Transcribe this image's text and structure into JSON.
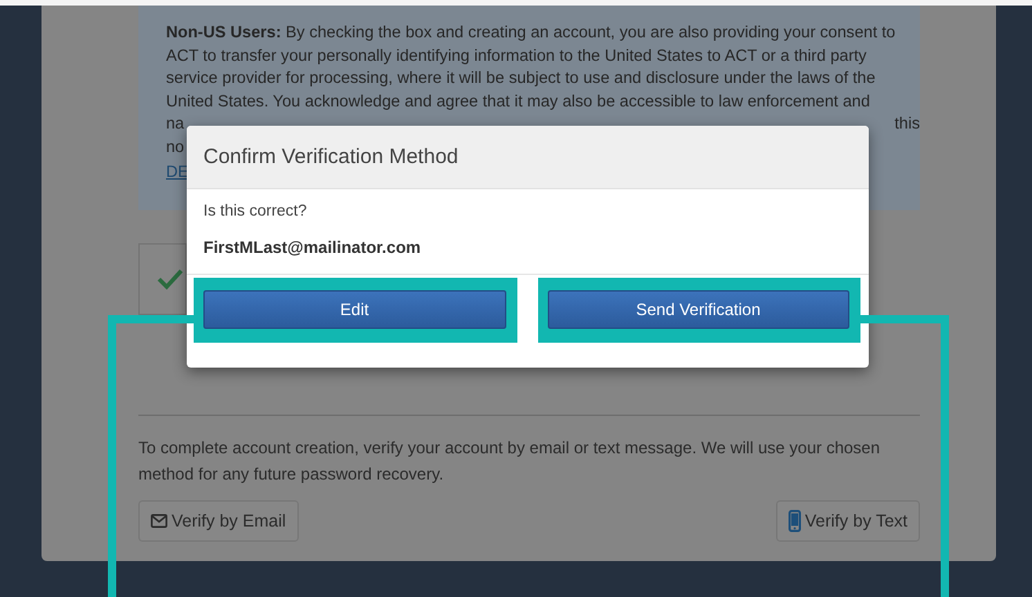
{
  "notice": {
    "text": "**Non-US Users:** By checking the box and creating an account, you are also providing your consent to ACT to transfer your personally identifying information to the United States to ACT or a third party service provider for processing, where it will be subject to use and disclosure under the laws of the United States. You acknowledge and agree that it may also be accessible to law enforcement and",
    "line5_start": "na",
    "line5_end": "this",
    "line6_start": "no",
    "link": "DE"
  },
  "consent_checkbox": {
    "checked": true
  },
  "verification": {
    "text": "To complete account creation, verify your account by email or text message. We will use your chosen method for any future password recovery.",
    "buttons": [
      {
        "label": "Verify by Email",
        "kind": "email"
      },
      {
        "label": "Verify by Text",
        "kind": "text"
      }
    ]
  },
  "modal": {
    "title": "Confirm Verification Method",
    "question": "Is this correct?",
    "email": "FirstMLast@mailinator.com",
    "buttons": [
      {
        "label": "Edit",
        "highlighted": true
      },
      {
        "label": "Send Verification",
        "highlighted": true
      }
    ]
  }
}
